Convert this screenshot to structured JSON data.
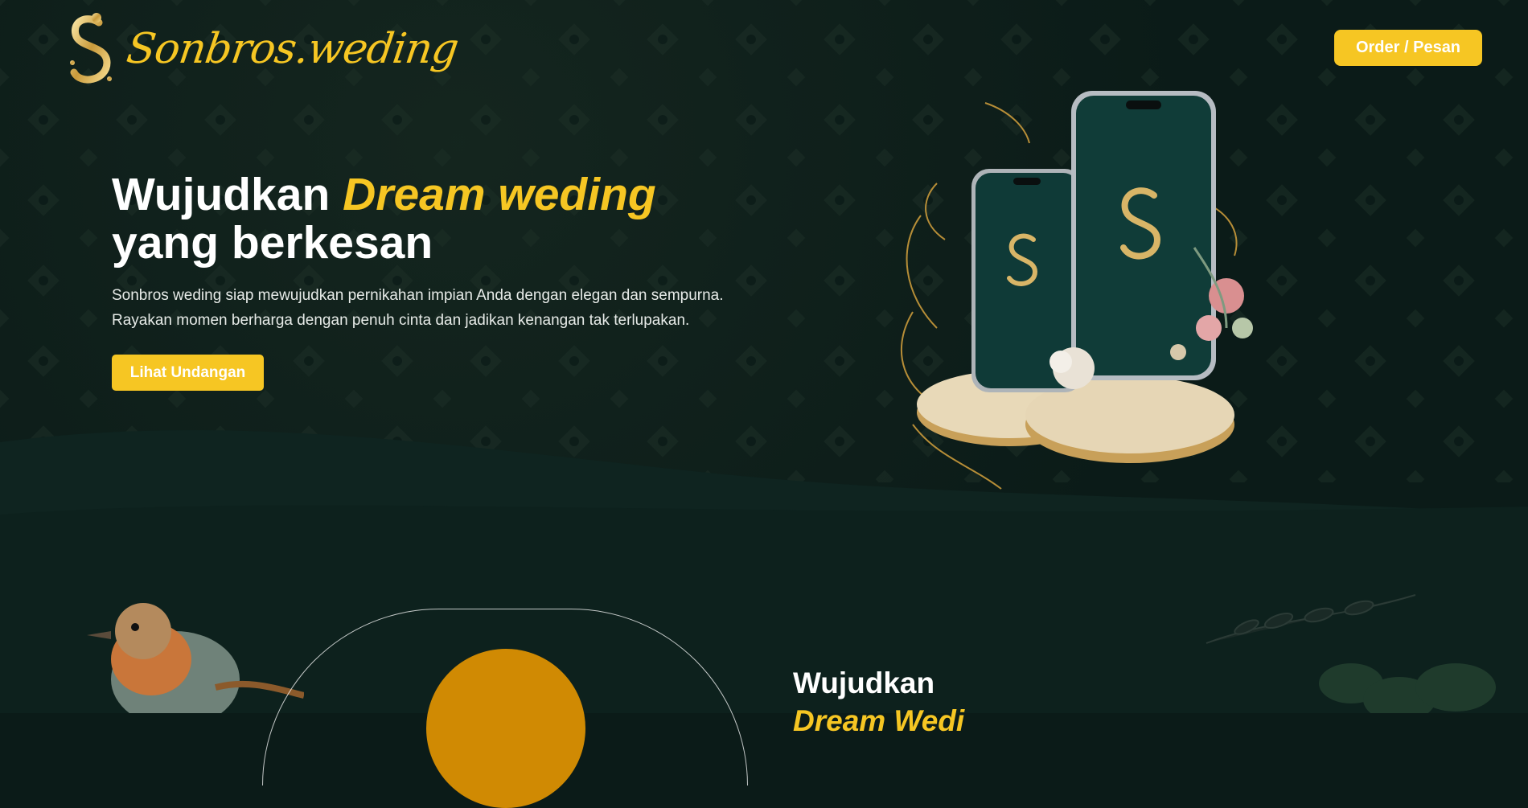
{
  "brand": {
    "name": "Sonbros.weding",
    "mark_letter": "S"
  },
  "header": {
    "order_label": "Order / Pesan"
  },
  "hero": {
    "title_line1": "Wujudkan ",
    "title_accent": "Dream weding",
    "title_line2": "yang berkesan",
    "description_line1": "Sonbros weding siap mewujudkan pernikahan impian Anda dengan elegan dan sempurna.",
    "description_line2": "Rayakan momen berharga dengan penuh cinta dan jadikan kenangan tak terlupakan.",
    "cta_label": "Lihat Undangan"
  },
  "section2": {
    "title_line1": "Wujudkan",
    "title_accent_partial": "Dream Wedi"
  },
  "icons": {
    "logo": "monogram-s-icon",
    "phones": "phone-mockup-illustration",
    "bird": "bird-illustration",
    "leaves": "leaf-branch-illustration"
  },
  "colors": {
    "background": "#0b1b18",
    "accent": "#f6c623",
    "gold_circle": "#d08a03",
    "text": "#ffffff"
  }
}
